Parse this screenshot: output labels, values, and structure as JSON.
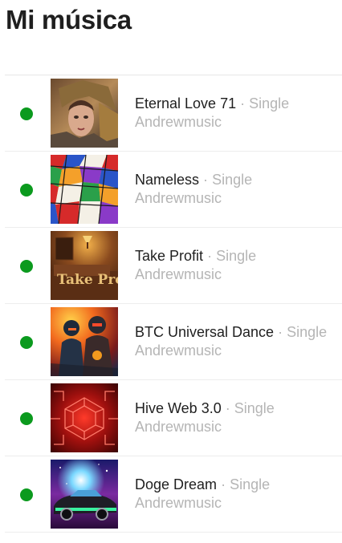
{
  "page": {
    "title": "Mi música"
  },
  "tracks": [
    {
      "title": "Eternal Love 71",
      "separator": "·",
      "type": "Single",
      "artist": "Andrewmusic",
      "status_color": "#0b9a1e",
      "cover_icon": "warrior-portrait-art"
    },
    {
      "title": "Nameless",
      "separator": "·",
      "type": "Single",
      "artist": "Andrewmusic",
      "status_color": "#0b9a1e",
      "cover_icon": "mosaic-art"
    },
    {
      "title": "Take Profit",
      "separator": "·",
      "type": "Single",
      "artist": "Andrewmusic",
      "status_color": "#0b9a1e",
      "cover_icon": "take-profit-room-art"
    },
    {
      "title": "BTC Universal Dance",
      "separator": "·",
      "type": "Single",
      "artist": "Andrewmusic",
      "status_color": "#0b9a1e",
      "cover_icon": "robot-dancers-art"
    },
    {
      "title": "Hive Web 3.0",
      "separator": "·",
      "type": "Single",
      "artist": "Andrewmusic",
      "status_color": "#0b9a1e",
      "cover_icon": "red-circuit-art"
    },
    {
      "title": "Doge Dream",
      "separator": "·",
      "type": "Single",
      "artist": "Andrewmusic",
      "status_color": "#0b9a1e",
      "cover_icon": "space-car-art"
    }
  ],
  "cover_text": {
    "take_profit": "Take Profit"
  }
}
